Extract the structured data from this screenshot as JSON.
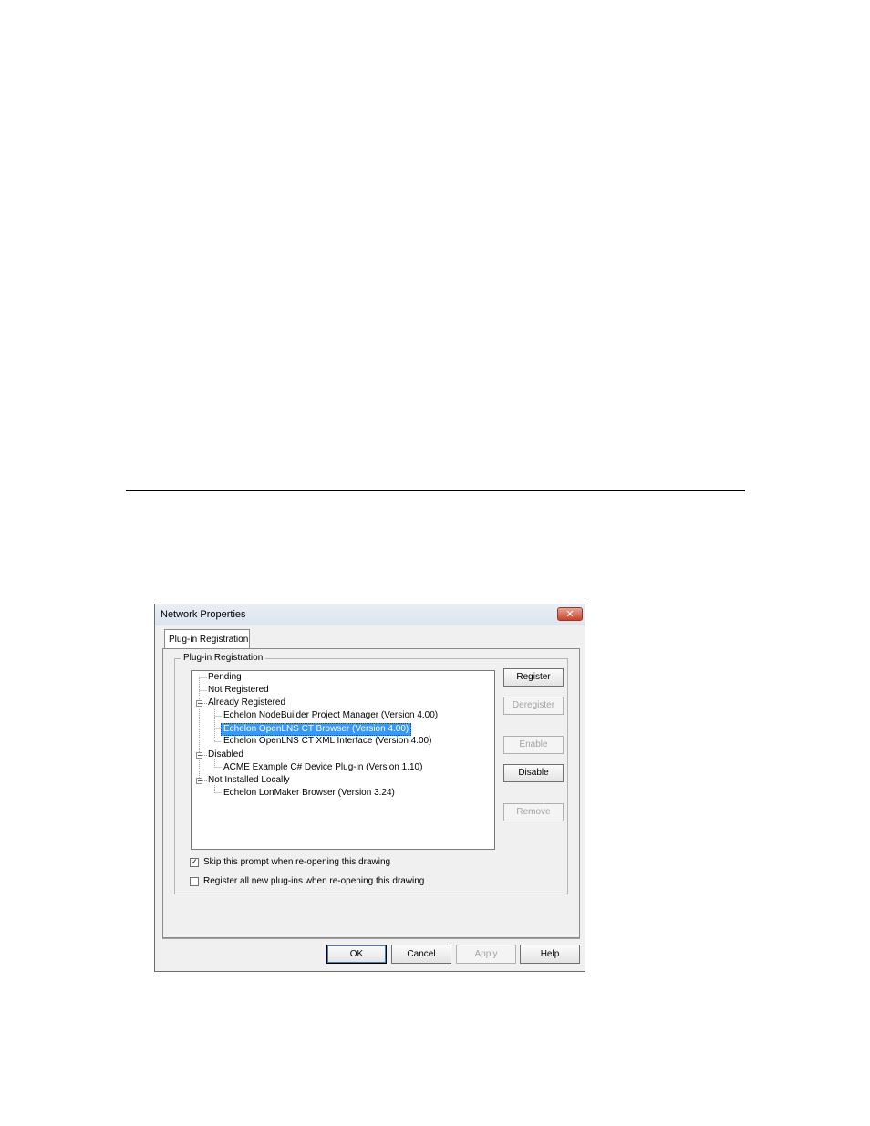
{
  "window": {
    "title": "Network Properties",
    "close_glyph": "✕"
  },
  "tabs": [
    {
      "label": "Plug-in Registration",
      "active": true
    }
  ],
  "group": {
    "label": "Plug-in Registration"
  },
  "tree": {
    "nodes": [
      {
        "label": "Pending",
        "level": 0,
        "expandable": false
      },
      {
        "label": "Not Registered",
        "level": 0,
        "expandable": false
      },
      {
        "label": "Already Registered",
        "level": 0,
        "expandable": true,
        "expanded": true
      },
      {
        "label": "Echelon NodeBuilder Project Manager (Version 4.00)",
        "level": 1
      },
      {
        "label": "Echelon OpenLNS CT Browser (Version 4.00)",
        "level": 1,
        "selected": true
      },
      {
        "label": "Echelon OpenLNS CT XML Interface (Version 4.00)",
        "level": 1
      },
      {
        "label": "Disabled",
        "level": 0,
        "expandable": true,
        "expanded": true
      },
      {
        "label": "ACME Example C# Device Plug-in (Version 1.10)",
        "level": 1
      },
      {
        "label": "Not Installed Locally",
        "level": 0,
        "expandable": true,
        "expanded": true
      },
      {
        "label": "Echelon LonMaker Browser (Version 3.24)",
        "level": 1
      }
    ],
    "expander_symbol": "−",
    "selection_color": "#3399ff"
  },
  "side_buttons": {
    "register": {
      "label": "Register",
      "enabled": true
    },
    "deregister": {
      "label": "Deregister",
      "enabled": false
    },
    "enable": {
      "label": "Enable",
      "enabled": false
    },
    "disable": {
      "label": "Disable",
      "enabled": true
    },
    "remove": {
      "label": "Remove",
      "enabled": false
    }
  },
  "options": {
    "skip_prompt": {
      "label": "Skip this prompt when re-opening this drawing",
      "checked": true,
      "mark": "✓"
    },
    "register_all": {
      "label": "Register all new plug-ins when re-opening this drawing",
      "checked": false,
      "mark": ""
    }
  },
  "footer_buttons": {
    "ok": {
      "label": "OK",
      "enabled": true
    },
    "cancel": {
      "label": "Cancel",
      "enabled": true
    },
    "apply": {
      "label": "Apply",
      "enabled": false
    },
    "help": {
      "label": "Help",
      "enabled": true
    }
  }
}
